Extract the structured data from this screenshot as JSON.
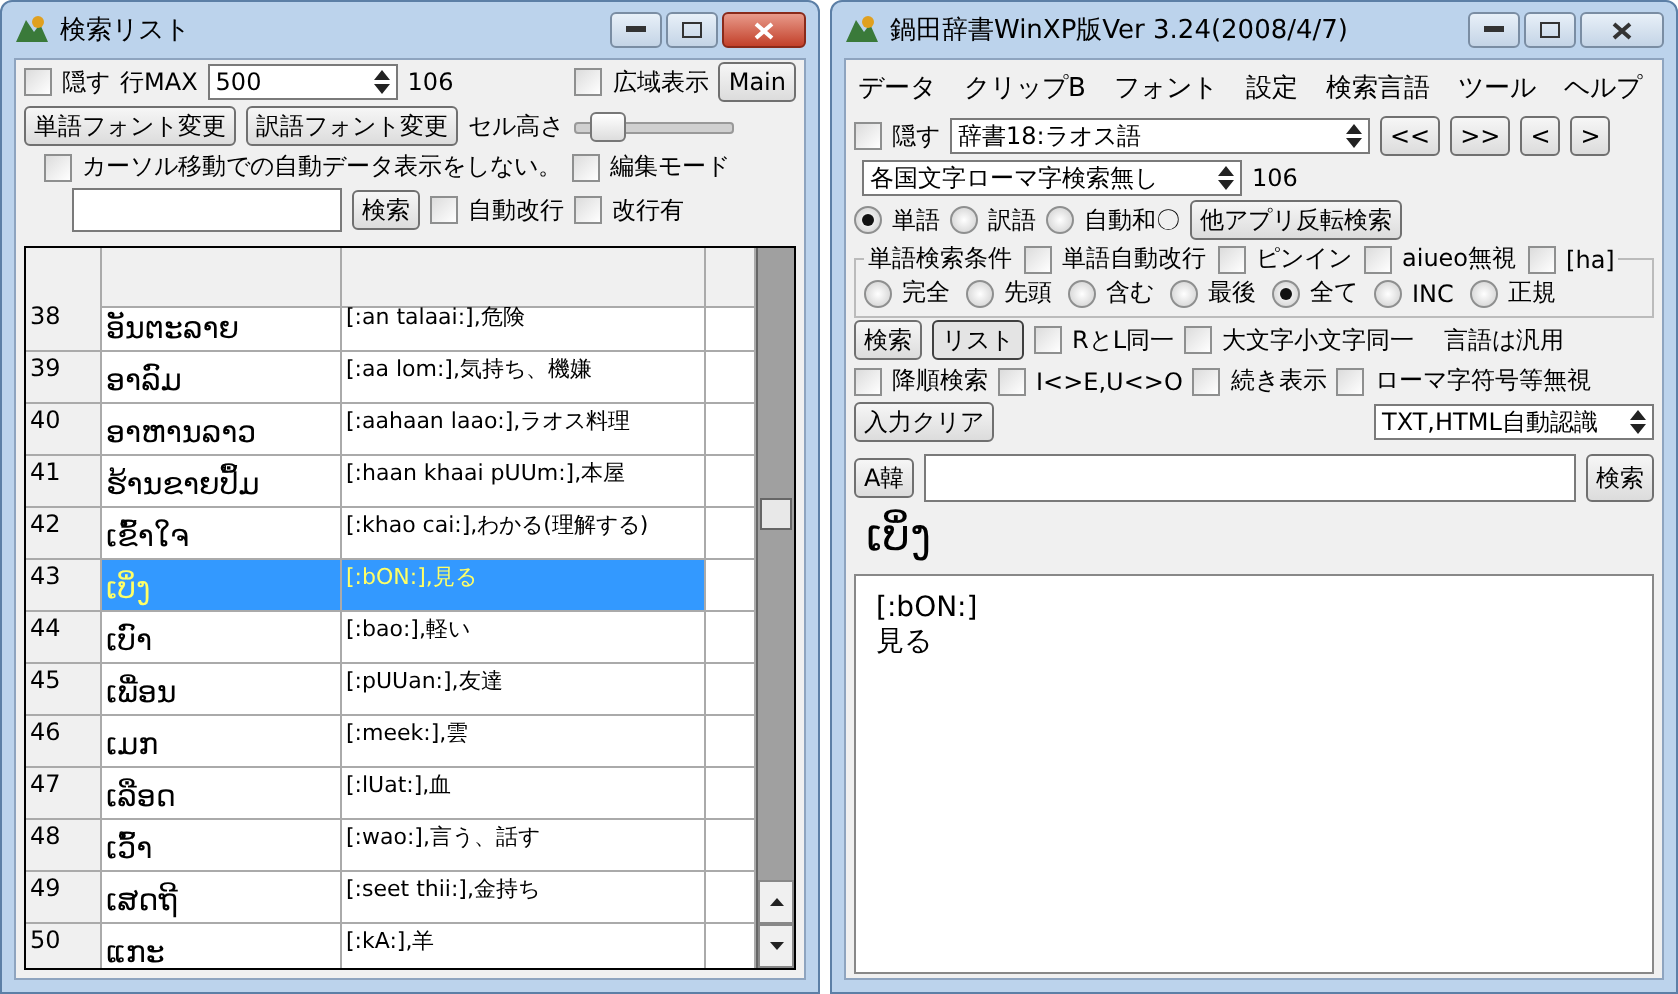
{
  "search_list_window": {
    "title": "検索リスト",
    "hide": {
      "label": "隠す",
      "checked": false
    },
    "row_max": {
      "label": "行MAX",
      "value": "500"
    },
    "count": "106",
    "wide_display": {
      "label": "広域表示",
      "checked": false
    },
    "main_button": "Main",
    "word_font_button": "単語フォント変更",
    "translation_font_button": "訳語フォント変更",
    "cell_height": {
      "label": "セル高さ",
      "level": 0.2
    },
    "no_auto_display": {
      "label": "カーソル移動での自動データ表示をしない。",
      "checked": false
    },
    "edit_mode": {
      "label": "編集モード",
      "checked": false
    },
    "search_button": "検索",
    "auto_wrap": {
      "label": "自動改行",
      "checked": false
    },
    "has_newline": {
      "label": "改行有",
      "checked": false
    },
    "table": {
      "rows": [
        {
          "number": "38",
          "word": "ອັນຕະລາຍ",
          "translation": "[:an talaai:],危険",
          "selected": false
        },
        {
          "number": "39",
          "word": "ອາລົມ",
          "translation": "[:aa lom:],気持ち、機嫌",
          "selected": false
        },
        {
          "number": "40",
          "word": "ອາຫານລາວ",
          "translation": "[:aahaan laao:],ラオス料理",
          "selected": false
        },
        {
          "number": "41",
          "word": "ຮ້ານຂາຍປຶ້ມ",
          "translation": "[:haan khaai pUUm:],本屋",
          "selected": false
        },
        {
          "number": "42",
          "word": "ເຂົ້າໃຈ",
          "translation": "[:khao cai:],わかる(理解する)",
          "selected": false
        },
        {
          "number": "43",
          "word": "ເບິ່ງ",
          "translation": "[:bON:],見る",
          "selected": true
        },
        {
          "number": "44",
          "word": "ເບົາ",
          "translation": "[:bao:],軽い",
          "selected": false
        },
        {
          "number": "45",
          "word": "ເພື່ອນ",
          "translation": "[:pUUan:],友達",
          "selected": false
        },
        {
          "number": "46",
          "word": "ເມກ",
          "translation": "[:meek:],雲",
          "selected": false
        },
        {
          "number": "47",
          "word": "ເລືອດ",
          "translation": "[:lUat:],血",
          "selected": false
        },
        {
          "number": "48",
          "word": "ເວົ້າ",
          "translation": "[:wao:],言う、話す",
          "selected": false
        },
        {
          "number": "49",
          "word": "ເສດຖີ",
          "translation": "[:seet thii:],金持ち",
          "selected": false
        },
        {
          "number": "50",
          "word": "ແກະ",
          "translation": "[:kA:],羊",
          "selected": false
        }
      ]
    }
  },
  "main_window": {
    "title": "鍋田辞書WinXP版Ver 3.24(2008/4/7)",
    "menu": [
      "データ",
      "クリップB",
      "フォント",
      "設定",
      "検索言語",
      "ツール",
      "ヘルプ"
    ],
    "hide": {
      "label": "隠す",
      "checked": false
    },
    "dictionary": "辞書18:ラオス語",
    "nav_buttons": [
      "<<",
      ">>",
      "<",
      ">"
    ],
    "script_search": "各国文字ローマ字検索無し",
    "count": "106",
    "search_target": [
      {
        "label": "単語",
        "selected": true
      },
      {
        "label": "訳語",
        "selected": false
      },
      {
        "label": "自動和〇",
        "selected": false
      }
    ],
    "reverse_search_button": "他アプリ反転検索",
    "conditions": {
      "legend": "単語検索条件",
      "options": [
        {
          "label": "単語自動改行",
          "checked": false
        },
        {
          "label": "ピンイン",
          "checked": false
        },
        {
          "label": "aiueo無視",
          "checked": false
        },
        {
          "label": "[ha]",
          "checked": false
        }
      ],
      "match": [
        {
          "label": "完全",
          "selected": false
        },
        {
          "label": "先頭",
          "selected": false
        },
        {
          "label": "含む",
          "selected": false
        },
        {
          "label": "最後",
          "selected": false
        },
        {
          "label": "全て",
          "selected": true
        },
        {
          "label": "INC",
          "selected": false
        },
        {
          "label": "正規",
          "selected": false
        }
      ]
    },
    "search_button": "検索",
    "list_button": "リスト",
    "same_options": [
      {
        "label": "RとL同一",
        "checked": false
      },
      {
        "label": "大文字小文字同一",
        "checked": false
      }
    ],
    "language_note": "言語は汎用",
    "more_options": [
      {
        "label": "降順検索",
        "checked": false
      },
      {
        "label": "I<>E,U<>O",
        "checked": false
      },
      {
        "label": "続き表示",
        "checked": false
      },
      {
        "label": "ローマ字符号等無視",
        "checked": false
      }
    ],
    "clear_button": "入力クリア",
    "format": "TXT,HTML自動認識",
    "korean_button": "A韓",
    "search_button_2": "検索",
    "headword": "ເບິ່ງ",
    "result_lines": [
      "[:bON:]",
      "見る"
    ]
  }
}
